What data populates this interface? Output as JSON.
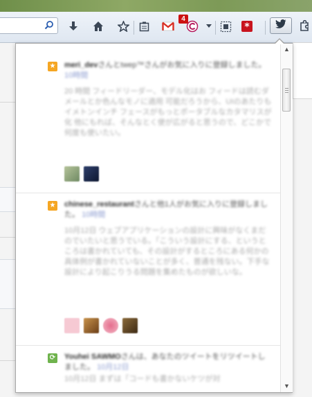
{
  "toolbar": {
    "url_value": "",
    "badge_count": "4",
    "icons": [
      "search-icon",
      "download-icon",
      "home-icon",
      "bookmark-star-icon",
      "reading-list-icon",
      "gmail-icon",
      "mail-notifier-icon",
      "dropdown-icon",
      "screenshot-icon",
      "lastpass-icon",
      "twitter-icon",
      "puzzle-icon"
    ]
  },
  "feed": {
    "items": [
      {
        "type": "favorite",
        "user": "meri_dev",
        "action": "さんとtwep™さんがお気に入りに登録しました。",
        "time": "10時間",
        "text": "20 時間 フィードリーダー、モデル化はお フィードは読むダメールとか色んなモノに適用 可能だろうから、UIのあたりもイメトンインチ フェースがもっとポータブルなカタマリスが化 他にもれば、そんなとく使が広がると思うので、どこかで何度も使いたい。"
      },
      {
        "type": "favorite",
        "user": "chinese_restaurant",
        "action": "さんと他1人がお気に入りに登録しました。",
        "time": "10時間",
        "text": "10月12日 ウェブアプリケーションの設計に興味がなくまだのでいたいと思うでいる。「こういう設計にする、というところは書かれていても、その設計がするところにある何かの具体例が書かれていないことが多く、普通を残ない。下手な設計により起こりうる問題を集めたものが欲しいな。"
      },
      {
        "type": "retweet",
        "user": "Youhei SAWMO",
        "action": "さんは、あなたのツイートをリツイートしました。",
        "time": "10月12日",
        "text": "10月12日 まずは「コードも書かないケツが対"
      }
    ]
  },
  "colors": {
    "favorite_icon": "#f5a623",
    "retweet_icon": "#6fb34d",
    "link_time": "#8b9bd0"
  }
}
